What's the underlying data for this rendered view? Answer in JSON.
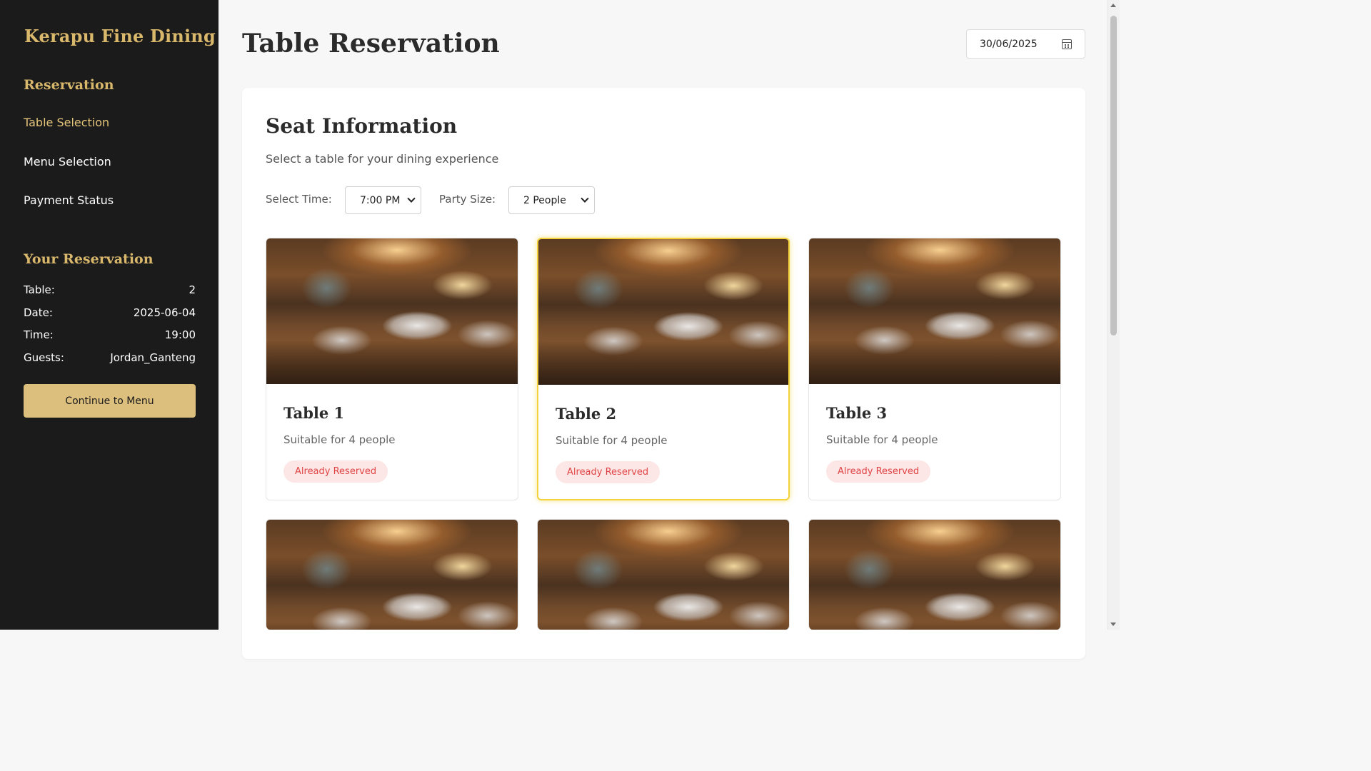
{
  "sidebar": {
    "brand": "Kerapu Fine Dining",
    "reservation_heading": "Reservation",
    "nav": [
      {
        "label": "Table Selection",
        "active": true
      },
      {
        "label": "Menu Selection",
        "active": false
      },
      {
        "label": "Payment Status",
        "active": false
      }
    ],
    "your_reservation_heading": "Your Reservation",
    "details": [
      {
        "label": "Table:",
        "value": "2"
      },
      {
        "label": "Date:",
        "value": "2025-06-04"
      },
      {
        "label": "Time:",
        "value": "19:00"
      },
      {
        "label": "Guests:",
        "value": "Jordan_Ganteng"
      }
    ],
    "continue_label": "Continue to Menu"
  },
  "header": {
    "title": "Table Reservation",
    "date_value": "30/06/2025"
  },
  "seat": {
    "title": "Seat Information",
    "subtitle": "Select a table for your dining experience",
    "time_label": "Select Time:",
    "time_value": "7:00 PM",
    "party_label": "Party Size:",
    "party_value": "2 People"
  },
  "tables": [
    {
      "name": "Table 1",
      "capacity": "Suitable for 4 people",
      "status": "Already Reserved",
      "selected": false
    },
    {
      "name": "Table 2",
      "capacity": "Suitable for 4 people",
      "status": "Already Reserved",
      "selected": true
    },
    {
      "name": "Table 3",
      "capacity": "Suitable for 4 people",
      "status": "Already Reserved",
      "selected": false
    },
    {
      "name": "",
      "capacity": "",
      "status": "",
      "selected": false
    },
    {
      "name": "",
      "capacity": "",
      "status": "",
      "selected": false
    },
    {
      "name": "",
      "capacity": "",
      "status": "",
      "selected": false
    }
  ],
  "colors": {
    "sidebar_bg": "#1b1b1b",
    "gold": "#d9b86c",
    "button_bg": "#dcbf7d",
    "selected_border": "#f3d23c",
    "reserved_bg": "#fde6e6",
    "reserved_text": "#e04545"
  }
}
